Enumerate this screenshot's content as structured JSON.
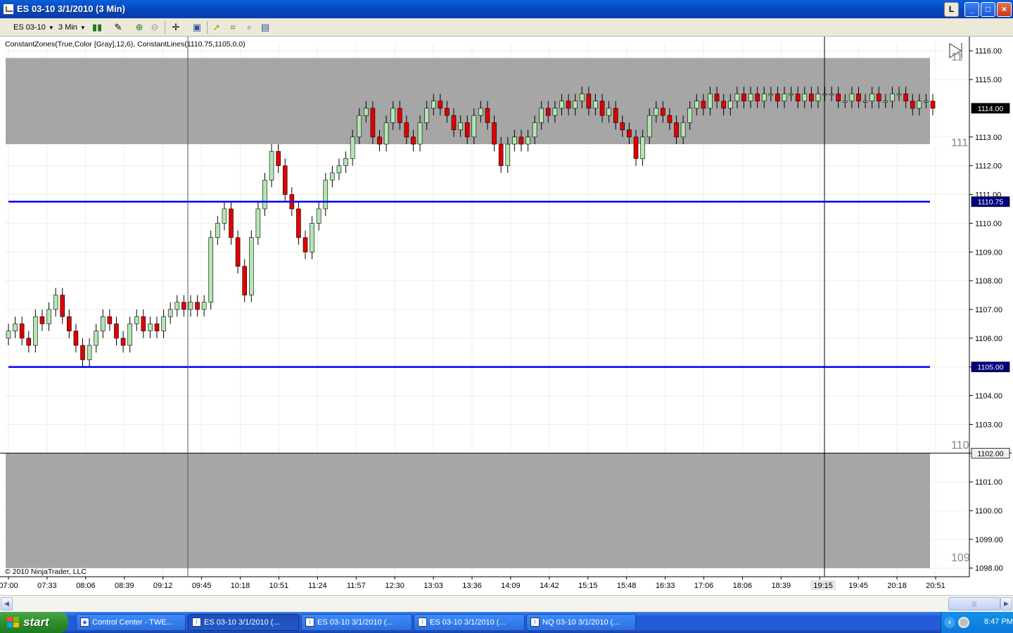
{
  "window": {
    "title": "ES 03-10  3/1/2010 (3 Min)",
    "buttons": [
      "L",
      "_",
      "□",
      "×"
    ]
  },
  "toolbar": {
    "instrument": "ES 03-10",
    "interval": "3 Min",
    "icons": [
      "bar-type-icon",
      "drawing-tool-icon",
      "zoom-in-icon",
      "zoom-out-icon",
      "crosshair-icon",
      "data-box-icon",
      "indicators-icon",
      "strategies-icon",
      "disabled-icon",
      "properties-icon"
    ]
  },
  "chart": {
    "indicator_label": "ConstantZones(True,Color [Gray],12,6), ConstantLines(1110.75,1105,0,0)",
    "copyright": "© 2010 NinjaTrader, LLC",
    "colors": {
      "zone": "#a6a6a6",
      "line": "#0000ff",
      "up": "#b3e6b3",
      "down": "#e00000",
      "label_bg": "#000080"
    },
    "y_ticks": [
      "1116.00",
      "1115.00",
      "1113.00",
      "1112.00",
      "1111.00",
      "1110.00",
      "1109.00",
      "1108.00",
      "1107.00",
      "1106.00",
      "1105.00",
      "1104.00",
      "1103.00",
      "1101.00",
      "1100.00",
      "1099.00",
      "1098.00"
    ],
    "x_ticks": [
      "07:00",
      "07:33",
      "08:06",
      "08:39",
      "09:12",
      "09:45",
      "10:18",
      "10:51",
      "11:24",
      "11:57",
      "12:30",
      "13:03",
      "13:36",
      "14:09",
      "14:42",
      "15:15",
      "15:48",
      "16:33",
      "17:06",
      "18:06",
      "18:39",
      "19:15",
      "19:45",
      "20:18",
      "20:51"
    ],
    "price_labels": {
      "last": "1114.00",
      "line_upper": "1110.75",
      "line_lower": "1105.00",
      "crosshair": "1102.00"
    },
    "time_label": "19:15",
    "overlay_texts": [
      "11",
      "111",
      "110",
      "109"
    ]
  },
  "chart_data": {
    "type": "candlestick",
    "title": "ES 03-10 3/1/2010 (3 Min)",
    "x_range": [
      "07:00",
      "20:51"
    ],
    "ylim": [
      1097.7,
      1116.25
    ],
    "zones": [
      {
        "from": 1112.75,
        "to": 1115.75
      },
      {
        "from": 1098.0,
        "to": 1102.0
      }
    ],
    "lines": [
      1110.75,
      1105.0
    ],
    "closes": [
      1106.25,
      1106.5,
      1106.0,
      1105.75,
      1106.75,
      1106.5,
      1107.0,
      1107.5,
      1106.75,
      1106.25,
      1105.75,
      1105.25,
      1105.75,
      1106.25,
      1106.75,
      1106.5,
      1106.0,
      1105.75,
      1106.5,
      1106.75,
      1106.25,
      1106.5,
      1106.25,
      1106.75,
      1107.0,
      1107.25,
      1107.0,
      1107.25,
      1107.0,
      1107.25,
      1109.5,
      1110.0,
      1110.5,
      1109.5,
      1108.5,
      1107.5,
      1109.5,
      1110.5,
      1111.5,
      1112.5,
      1112.0,
      1111.0,
      1110.5,
      1109.5,
      1109.0,
      1110.0,
      1110.5,
      1111.5,
      1111.75,
      1112.0,
      1112.25,
      1113.0,
      1113.75,
      1114.0,
      1113.0,
      1112.75,
      1113.5,
      1114.0,
      1113.5,
      1113.0,
      1112.75,
      1113.5,
      1114.0,
      1114.25,
      1114.0,
      1113.75,
      1113.25,
      1113.5,
      1113.0,
      1113.75,
      1114.0,
      1113.5,
      1112.75,
      1112.0,
      1112.75,
      1113.0,
      1112.75,
      1113.0,
      1113.5,
      1114.0,
      1113.75,
      1114.0,
      1114.25,
      1114.0,
      1114.25,
      1114.5,
      1114.0,
      1114.25,
      1113.75,
      1114.0,
      1113.5,
      1113.25,
      1113.0,
      1112.25,
      1113.0,
      1113.75,
      1114.0,
      1113.75,
      1113.5,
      1113.0,
      1113.5,
      1114.0,
      1114.25,
      1114.0,
      1114.5,
      1114.25,
      1114.0,
      1114.25,
      1114.5,
      1114.25,
      1114.5,
      1114.25,
      1114.5,
      1114.5,
      1114.25,
      1114.5,
      1114.5,
      1114.25,
      1114.5,
      1114.25,
      1114.5,
      1114.5,
      1114.5,
      1114.25,
      1114.25,
      1114.5,
      1114.25,
      1114.25,
      1114.5,
      1114.25,
      1114.25,
      1114.5,
      1114.5,
      1114.25,
      1114.0,
      1114.25,
      1114.25,
      1114.0
    ]
  }
}
